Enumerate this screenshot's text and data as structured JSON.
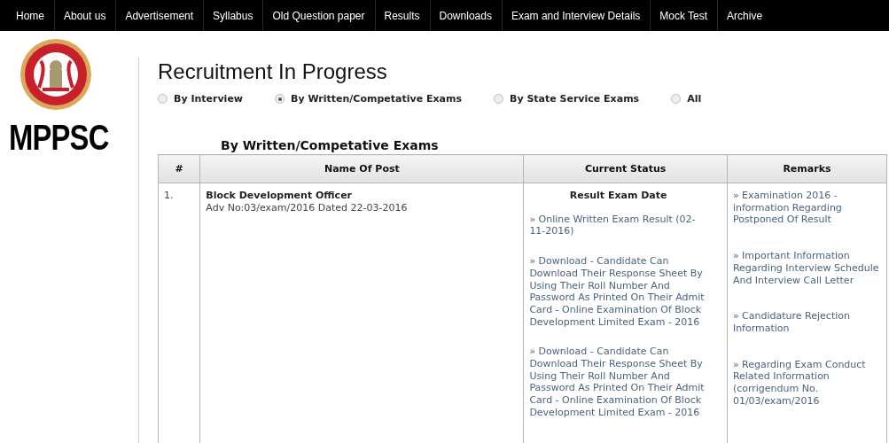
{
  "nav": {
    "items": [
      {
        "label": "Home"
      },
      {
        "label": "About us"
      },
      {
        "label": "Advertisement"
      },
      {
        "label": "Syllabus"
      },
      {
        "label": "Old Question paper"
      },
      {
        "label": "Results"
      },
      {
        "label": "Downloads"
      },
      {
        "label": "Exam and Interview Details"
      },
      {
        "label": "Mock Test"
      },
      {
        "label": "Archive"
      }
    ]
  },
  "sidebar": {
    "logo_text": "MPPSC"
  },
  "page": {
    "title": "Recruitment In Progress",
    "filters": [
      {
        "label": "By Interview",
        "selected": false
      },
      {
        "label": "By Written/Competative Exams",
        "selected": true
      },
      {
        "label": "By State Service Exams",
        "selected": false
      },
      {
        "label": "All",
        "selected": false
      }
    ],
    "section_title": "By Written/Competative Exams"
  },
  "table": {
    "columns": [
      "#",
      "Name Of Post",
      "Current Status",
      "Remarks"
    ],
    "rows": [
      {
        "number": "1.",
        "post": "Block Development Officer",
        "advertisement": "Adv No:03/exam/2016 Dated 22-03-2016",
        "status_heading": "Result Exam Date",
        "status_links": [
          "» Online Written Exam Result (02-11-2016)",
          "» Download - Candidate Can Download Their Response Sheet By Using Their Roll Number And Password As Printed On Their Admit Card - Online Examination Of Block Development Limited Exam - 2016",
          "» Download - Candidate Can Download Their Response Sheet By Using Their Roll Number And Password As Printed On Their Admit Card - Online Examination Of Block Development Limited Exam - 2016"
        ],
        "remarks": [
          "» Examination 2016 - information Regarding Postponed Of Result",
          "» Important Information Regarding Interview Schedule And Interview Call Letter",
          "» Candidature Rejection Information",
          "» Regarding Exam Conduct Related Information (corrigendum No. 01/03/exam/2016"
        ]
      }
    ]
  }
}
